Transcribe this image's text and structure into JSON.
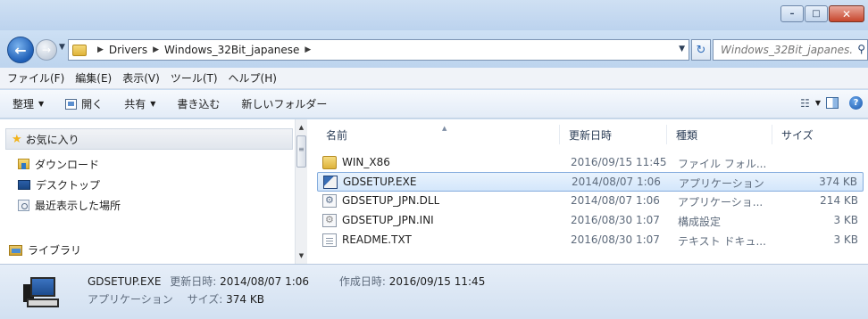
{
  "window": {
    "minimize_glyph": "–",
    "maximize_glyph": "□",
    "close_glyph": "✕"
  },
  "address": {
    "crumbs": [
      "Drivers",
      "Windows_32Bit_japanese"
    ],
    "search_placeholder": "Windows_32Bit_japanes..."
  },
  "menu": {
    "items": [
      "ファイル(F)",
      "編集(E)",
      "表示(V)",
      "ツール(T)",
      "ヘルプ(H)"
    ]
  },
  "toolbar": {
    "organize": "整理",
    "open": "開く",
    "share": "共有",
    "burn": "書き込む",
    "new_folder": "新しいフォルダー"
  },
  "nav": {
    "favorites": "お気に入り",
    "items": [
      "ダウンロード",
      "デスクトップ",
      "最近表示した場所"
    ],
    "library": "ライブラリ"
  },
  "columns": {
    "name": "名前",
    "date": "更新日時",
    "type": "種類",
    "size": "サイズ"
  },
  "files": [
    {
      "name": "WIN_X86",
      "date": "2016/09/15 11:45",
      "type": "ファイル フォル...",
      "size": "",
      "icon": "folder-icon"
    },
    {
      "name": "GDSETUP.EXE",
      "date": "2014/08/07 1:06",
      "type": "アプリケーション",
      "size": "374 KB",
      "icon": "exe-icon"
    },
    {
      "name": "GDSETUP_JPN.DLL",
      "date": "2014/08/07 1:06",
      "type": "アプリケーショ...",
      "size": "214 KB",
      "icon": "dll-icon"
    },
    {
      "name": "GDSETUP_JPN.INI",
      "date": "2016/08/30 1:07",
      "type": "構成設定",
      "size": "3 KB",
      "icon": "ini-icon"
    },
    {
      "name": "README.TXT",
      "date": "2016/08/30 1:07",
      "type": "テキスト ドキュ...",
      "size": "3 KB",
      "icon": "txt-icon"
    }
  ],
  "details": {
    "name": "GDSETUP.EXE",
    "modified_label": "更新日時:",
    "modified": "2014/08/07 1:06",
    "created_label": "作成日時:",
    "created": "2016/09/15 11:45",
    "type": "アプリケーション",
    "size_label": "サイズ:",
    "size": "374 KB"
  }
}
